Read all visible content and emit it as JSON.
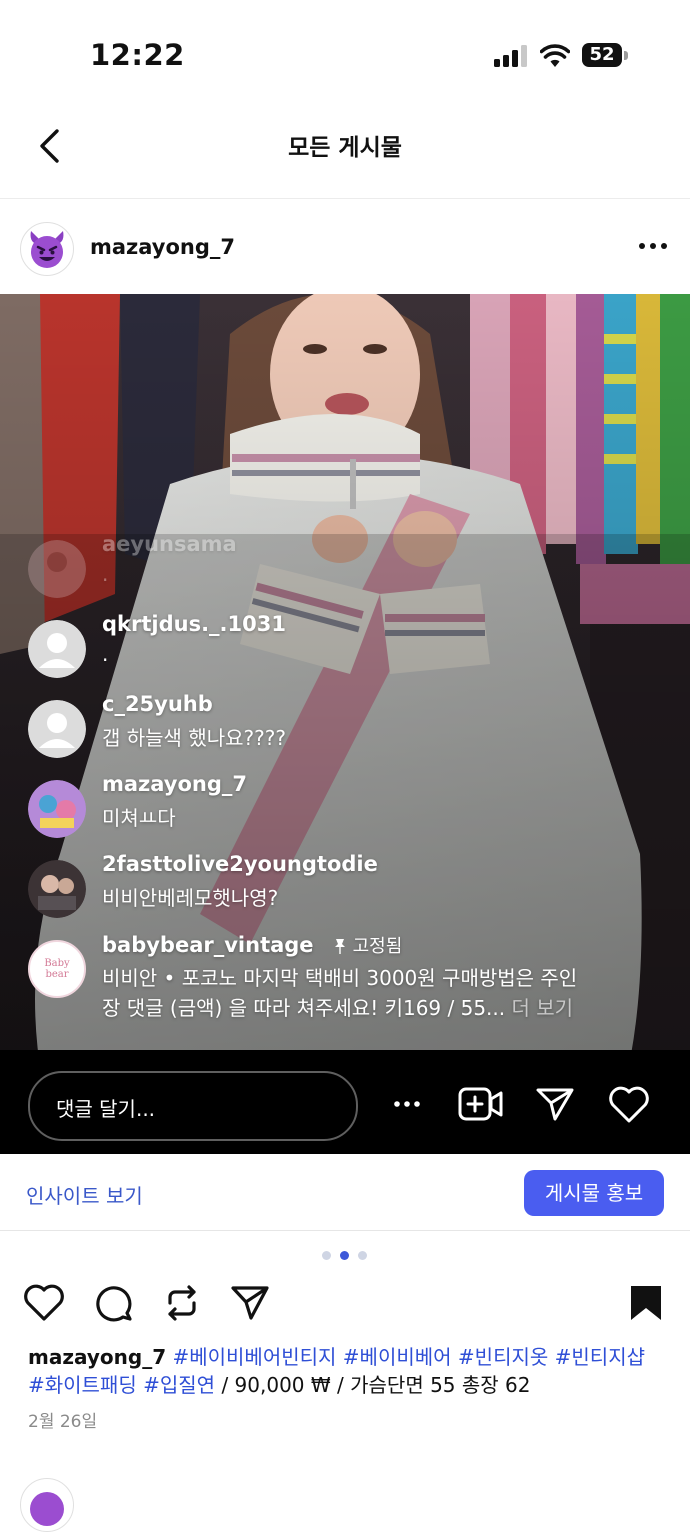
{
  "status_bar": {
    "time": "12:22",
    "battery": "52"
  },
  "nav": {
    "title": "모든 게시물"
  },
  "post": {
    "username": "mazayong_7",
    "comments": [
      {
        "user": "aeyunsama",
        "text": "."
      },
      {
        "user": "qkrtjdus._.1031",
        "text": "."
      },
      {
        "user": "c_25yuhb",
        "text": "갭 하늘색 했나요????"
      },
      {
        "user": "mazayong_7",
        "text": "미쳐ㅛ다"
      },
      {
        "user": "2fasttolive2youngtodie",
        "text": "비비안베레모햇나영?"
      },
      {
        "user": "babybear_vintage",
        "pinned": "고정됨",
        "text_line1": "비비안 • 포코노 마지막 택배비 3000원 구매방법은 주인",
        "text_line2": "장 댓글 (금액) 을 따라 쳐주세요! 키169 / 55...",
        "more": "더 보기",
        "avatar_text": "Baby bear"
      }
    ],
    "comment_placeholder": "댓글 달기..."
  },
  "insight": {
    "link": "인사이트 보기",
    "promote": "게시물 홍보"
  },
  "caption": {
    "username": "mazayong_7",
    "hashtags_line1": [
      "#베이비베어빈티지",
      "#베이비베어",
      "#빈티지옷",
      "#빈티지샵"
    ],
    "hashtags_line2": [
      "#화이트패딩",
      "#입질연"
    ],
    "details": " / 90,000 ₩ / 가슴단면 55 총장 62",
    "date": "2월 26일"
  },
  "icons": {
    "back": "chevron-left-icon",
    "more": "more-horizontal-icon",
    "avatar": "smiling-devil-icon",
    "pin": "pin-icon",
    "camera": "video-add-icon",
    "send": "send-icon",
    "heart": "heart-icon",
    "comment": "comment-bubble-icon",
    "repost": "repost-icon",
    "save": "bookmark-filled-icon"
  },
  "colors": {
    "accent": "#4a5df0",
    "hashtag": "#2f4fd6",
    "link": "#3a58c9"
  }
}
